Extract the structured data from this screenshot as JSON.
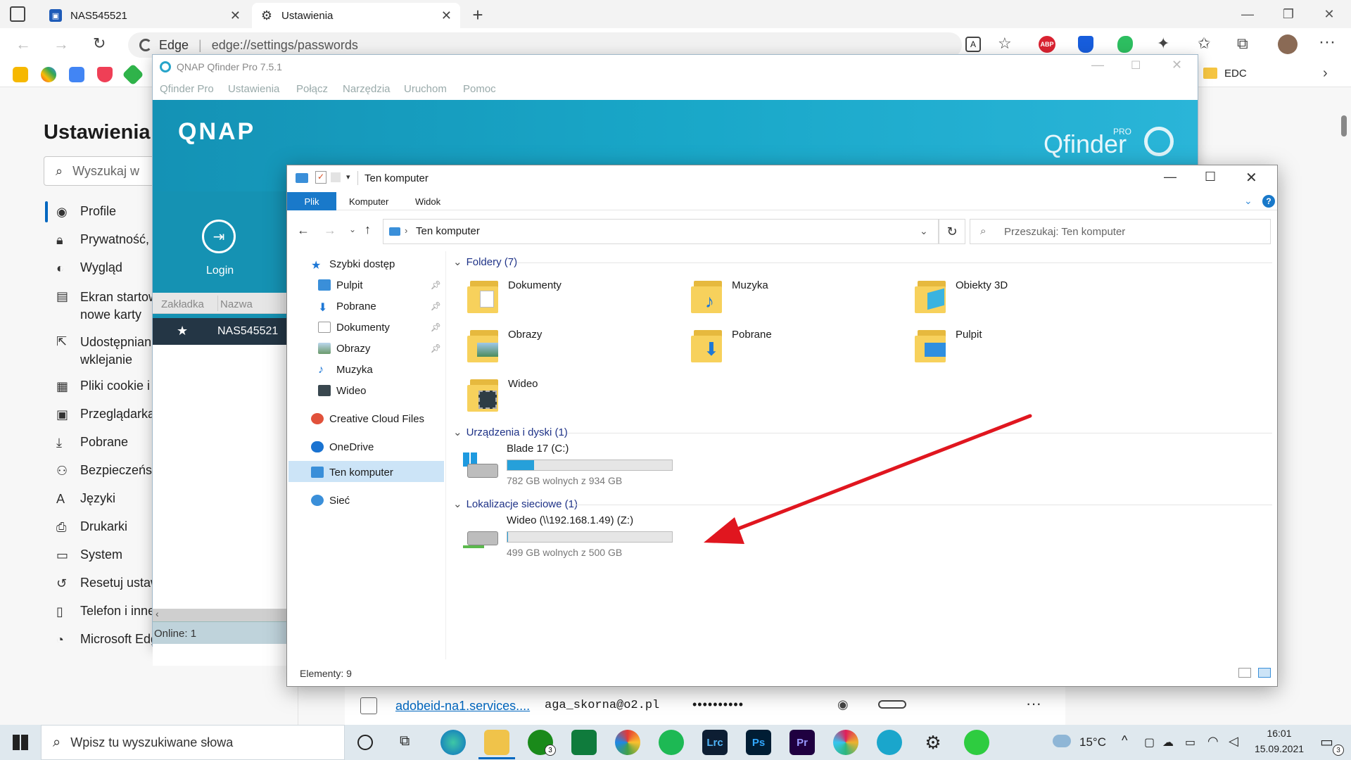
{
  "browser": {
    "tabs": [
      {
        "title": "NAS545521"
      },
      {
        "title": "Ustawienia"
      }
    ],
    "url_prefix": "Edge",
    "url": "edge://settings/passwords",
    "fav_folder": "EDC",
    "ext_abp": "ABP"
  },
  "settings": {
    "title": "Ustawienia",
    "search_placeholder": "Wyszukaj w",
    "menu": [
      {
        "label": "Profile"
      },
      {
        "label": "Prywatność, w"
      },
      {
        "label": "Wygląd"
      },
      {
        "label": "Ekran startow",
        "label2": "nowe karty"
      },
      {
        "label": "Udostępnian",
        "label2": "wklejanie"
      },
      {
        "label": "Pliki cookie i"
      },
      {
        "label": "Przeglądarka"
      },
      {
        "label": "Pobrane"
      },
      {
        "label": "Bezpieczeńst"
      },
      {
        "label": "Języki"
      },
      {
        "label": "Drukarki"
      },
      {
        "label": "System"
      },
      {
        "label": "Resetuj ustaw"
      },
      {
        "label": "Telefon i inne"
      },
      {
        "label": "Microsoft Edg"
      }
    ],
    "password_row": {
      "site": "adobeid-na1.services....",
      "user": "aga_skorna@o2.pl",
      "password": "••••••••••",
      "more": "···"
    }
  },
  "qnap": {
    "title": "QNAP Qfinder Pro 7.5.1",
    "menu": [
      "Qfinder Pro",
      "Ustawienia",
      "Połącz",
      "Narzędzia",
      "Uruchom",
      "Pomoc"
    ],
    "logo": "QNAP",
    "brand": "Qfinder",
    "brand_badge": "PRO",
    "login_label": "Login",
    "columns": [
      "Zakładka",
      "Nazwa"
    ],
    "device": "NAS545521",
    "status": "Online: 1"
  },
  "explorer": {
    "title": "Ten komputer",
    "ribbon": [
      "Plik",
      "Komputer",
      "Widok"
    ],
    "help": "?",
    "breadcrumb": "Ten komputer",
    "search_placeholder": "Przeszukaj: Ten komputer",
    "nav": {
      "quick_access": "Szybki dostęp",
      "pinned": [
        "Pulpit",
        "Pobrane",
        "Dokumenty",
        "Obrazy",
        "Muzyka",
        "Wideo"
      ],
      "creative_cloud": "Creative Cloud Files",
      "onedrive": "OneDrive",
      "this_pc": "Ten komputer",
      "network": "Sieć"
    },
    "groups": {
      "folders": "Foldery (7)",
      "drives": "Urządzenia i dyski (1)",
      "network": "Lokalizacje sieciowe (1)"
    },
    "folders": [
      "Dokumenty",
      "Muzyka",
      "Obiekty 3D",
      "Obrazy",
      "Pobrane",
      "Pulpit",
      "Wideo"
    ],
    "drives": [
      {
        "name": "Blade 17 (C:)",
        "free": "782 GB wolnych z 934 GB",
        "used_fraction": 0.163
      }
    ],
    "network_drives": [
      {
        "name": "Wideo (\\\\192.168.1.49) (Z:)",
        "free": "499 GB wolnych z 500 GB",
        "used_fraction": 0.002
      }
    ],
    "status": "Elementy: 9"
  },
  "taskbar": {
    "search": "Wpisz tu wyszukiwane słowa",
    "badge_xbox": "3",
    "lrc": "Lrc",
    "ps": "Ps",
    "pr": "Pr",
    "weather": "15°C",
    "time": "16:01",
    "date": "15.09.2021",
    "notifications": "3"
  },
  "colors": {
    "accent": "#0067c0",
    "qnap_teal": "#1592b3",
    "arrow_red": "#e0161f",
    "explorer_plik": "#1979ca",
    "drive_bar": "#26a0da"
  }
}
